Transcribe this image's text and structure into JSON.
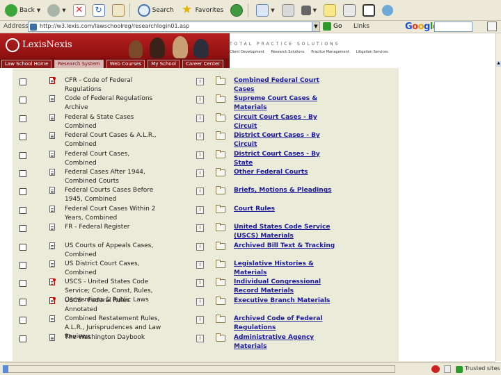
{
  "toolbar": {
    "back_label": "Back",
    "favorites_label": "Favorites"
  },
  "address": {
    "label": "Address",
    "url": "http://w3.lexis.com/lawschoolreg/researchlogin01.asp",
    "go_label": "Go",
    "links_label": "Links"
  },
  "google": {
    "logo": "Google"
  },
  "banner": {
    "brand": "LexisNexis",
    "tagline": "TOTAL PRACTICE SOLUTIONS",
    "subnav": [
      "Client Development",
      "Research Solutions",
      "Practice Management",
      "Litigation Services"
    ],
    "tabs": [
      "Law School Home",
      "Research System",
      "Web Courses",
      "My School",
      "Career Center"
    ],
    "active_tab": "Research System"
  },
  "sources": [
    {
      "name": "CFR - Code of Federal Regulations",
      "icon": "red",
      "link": "Combined Federal Court Cases"
    },
    {
      "name": "Code of Federal Regulations Archive",
      "icon": "doc",
      "link": "Supreme Court Cases & Materials"
    },
    {
      "name": "Federal & State Cases Combined",
      "icon": "doc",
      "link": "Circuit Court Cases - By Circuit"
    },
    {
      "name": "Federal Court Cases & A.L.R., Combined",
      "icon": "doc",
      "link": "District Court Cases - By Circuit"
    },
    {
      "name": "Federal Court Cases, Combined",
      "icon": "doc",
      "link": "District Court Cases - By State"
    },
    {
      "name": "Federal Cases After 1944, Combined Courts",
      "icon": "doc",
      "link": "Other Federal Courts"
    },
    {
      "name": "Federal Courts Cases Before 1945, Combined",
      "icon": "doc",
      "link": "Briefs, Motions & Pleadings"
    },
    {
      "name": "Federal Court Cases Within 2 Years, Combined",
      "icon": "doc",
      "link": "Court Rules"
    },
    {
      "name": "FR - Federal Register",
      "icon": "doc",
      "link": "United States Code Service (USCS) Materials"
    },
    {
      "name": "US Courts of Appeals Cases, Combined",
      "icon": "doc",
      "link": "Archived Bill Text & Tracking"
    },
    {
      "name": "US District Court Cases, Combined",
      "icon": "doc",
      "link": "Legislative Histories & Materials"
    },
    {
      "name": "USCS - United States Code Service; Code, Const, Rules, Conventions & Public Laws",
      "icon": "red",
      "link": "Individual Congressional Record Materials"
    },
    {
      "name": "USCS - Federal Rules Annotated",
      "icon": "red",
      "link": "Executive Branch Materials"
    },
    {
      "name": "Combined Restatement Rules, A.L.R., Jurisprudences and Law Reviews",
      "icon": "doc",
      "link": "Archived Code of Federal Regulations"
    },
    {
      "name": "The Washington Daybook",
      "icon": "doc",
      "link": "Administrative Agency Materials"
    }
  ],
  "status": {
    "zone": "Trusted sites"
  }
}
